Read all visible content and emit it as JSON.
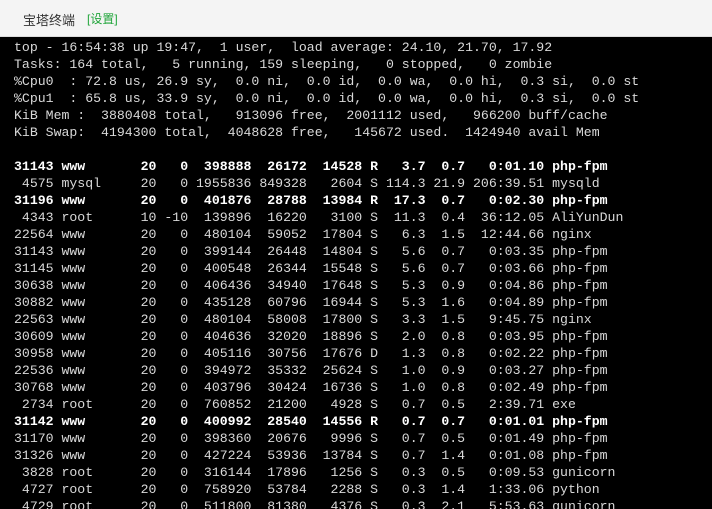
{
  "titlebar": {
    "title": "宝塔终端",
    "settings_label": "[设置]"
  },
  "terminal": {
    "summary": [
      "top - 16:54:38 up 19:47,  1 user,  load average: 24.10, 21.70, 17.92",
      "Tasks: 164 total,   5 running, 159 sleeping,   0 stopped,   0 zombie",
      "%Cpu0  : 72.8 us, 26.9 sy,  0.0 ni,  0.0 id,  0.0 wa,  0.0 hi,  0.3 si,  0.0 st",
      "%Cpu1  : 65.8 us, 33.9 sy,  0.0 ni,  0.0 id,  0.0 wa,  0.0 hi,  0.3 si,  0.0 st",
      "KiB Mem :  3880408 total,   913096 free,  2001112 used,   966200 buff/cache",
      "KiB Swap:  4194300 total,  4048628 free,   145672 used.  1424940 avail Mem"
    ],
    "processes": [
      {
        "text": "31143 www       20   0  398888  26172  14528 R   3.7  0.7   0:01.10 php-fpm",
        "bold": true
      },
      {
        "text": " 4575 mysql     20   0 1955836 849328   2604 S 114.3 21.9 206:39.51 mysqld",
        "bold": false
      },
      {
        "text": "31196 www       20   0  401876  28788  13984 R  17.3  0.7   0:02.30 php-fpm",
        "bold": true
      },
      {
        "text": " 4343 root      10 -10  139896  16220   3100 S  11.3  0.4  36:12.05 AliYunDun",
        "bold": false
      },
      {
        "text": "22564 www       20   0  480104  59052  17804 S   6.3  1.5  12:44.66 nginx",
        "bold": false
      },
      {
        "text": "31143 www       20   0  399144  26448  14804 S   5.6  0.7   0:03.35 php-fpm",
        "bold": false
      },
      {
        "text": "31145 www       20   0  400548  26344  15548 S   5.6  0.7   0:03.66 php-fpm",
        "bold": false
      },
      {
        "text": "30638 www       20   0  406436  34940  17648 S   5.3  0.9   0:04.86 php-fpm",
        "bold": false
      },
      {
        "text": "30882 www       20   0  435128  60796  16944 S   5.3  1.6   0:04.89 php-fpm",
        "bold": false
      },
      {
        "text": "22563 www       20   0  480104  58008  17800 S   3.3  1.5   9:45.75 nginx",
        "bold": false
      },
      {
        "text": "30609 www       20   0  404636  32020  18896 S   2.0  0.8   0:03.95 php-fpm",
        "bold": false
      },
      {
        "text": "30958 www       20   0  405116  30756  17676 D   1.3  0.8   0:02.22 php-fpm",
        "bold": false
      },
      {
        "text": "22536 www       20   0  394972  35332  25624 S   1.0  0.9   0:03.27 php-fpm",
        "bold": false
      },
      {
        "text": "30768 www       20   0  403796  30424  16736 S   1.0  0.8   0:02.49 php-fpm",
        "bold": false
      },
      {
        "text": " 2734 root      20   0  760852  21200   4928 S   0.7  0.5   2:39.71 exe",
        "bold": false
      },
      {
        "text": "31142 www       20   0  400992  28540  14556 R   0.7  0.7   0:01.01 php-fpm",
        "bold": true
      },
      {
        "text": "31170 www       20   0  398360  20676   9996 S   0.7  0.5   0:01.49 php-fpm",
        "bold": false
      },
      {
        "text": "31326 www       20   0  427224  53936  13784 S   0.7  1.4   0:01.08 php-fpm",
        "bold": false
      },
      {
        "text": " 3828 root      20   0  316144  17896   1256 S   0.3  0.5   0:09.53 gunicorn",
        "bold": false
      },
      {
        "text": " 4727 root      20   0  758920  53784   2288 S   0.3  1.4   1:33.06 python",
        "bold": false
      },
      {
        "text": " 4729 root      20   0  511800  81380   4376 S   0.3  2.1   5:53.63 gunicorn",
        "bold": false
      }
    ]
  }
}
